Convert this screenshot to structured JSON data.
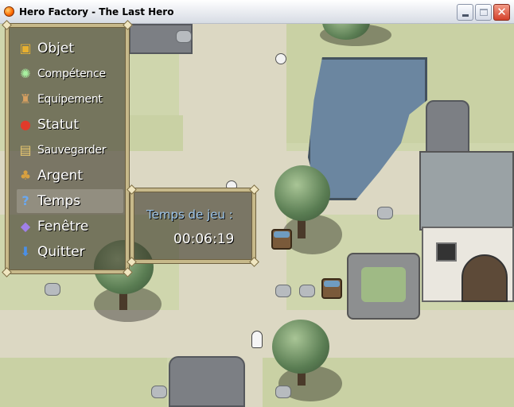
{
  "window": {
    "title": "Hero Factory - The Last Hero",
    "close_glyph": "✕"
  },
  "menu": {
    "items": [
      {
        "label": "Objet",
        "icon": "chest-icon",
        "glyph": "▣",
        "color": "#e8b030"
      },
      {
        "label": "Compétence",
        "icon": "sparkle-icon",
        "glyph": "✺",
        "color": "#a8f0a0"
      },
      {
        "label": "Equipement",
        "icon": "armor-icon",
        "glyph": "♜",
        "color": "#d8a060"
      },
      {
        "label": "Statut",
        "icon": "apple-icon",
        "glyph": "●",
        "color": "#e03a2a"
      },
      {
        "label": "Sauvegarder",
        "icon": "scroll-icon",
        "glyph": "▤",
        "color": "#e8c870"
      },
      {
        "label": "Argent",
        "icon": "money-bag-icon",
        "glyph": "♣",
        "color": "#d8a040"
      },
      {
        "label": "Temps",
        "icon": "question-icon",
        "glyph": "?",
        "color": "#6aa8f0"
      },
      {
        "label": "Fenêtre",
        "icon": "gem-icon",
        "glyph": "◆",
        "color": "#a080e8"
      },
      {
        "label": "Quitter",
        "icon": "arrow-down-icon",
        "glyph": "⬇",
        "color": "#4a90e8"
      }
    ],
    "selected_index": 6
  },
  "playtime": {
    "label": "Temps de jeu :",
    "value": "00:06:19"
  }
}
